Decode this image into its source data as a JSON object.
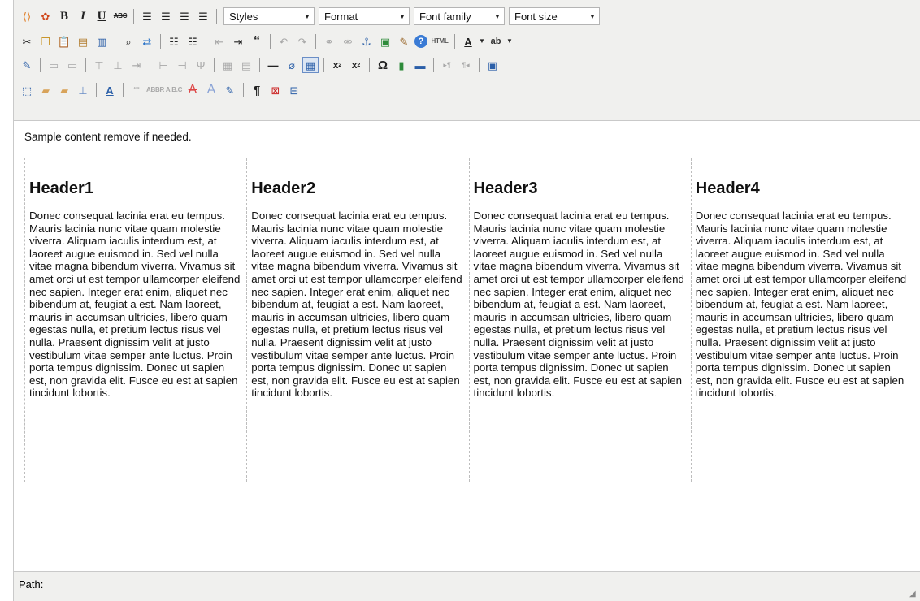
{
  "toolbar": {
    "styles_value": "Styles",
    "format_value": "Format",
    "fontfamily_value": "Font family",
    "fontsize_value": "Font size",
    "html_label": "HTML"
  },
  "content": {
    "sample_text": "Sample content remove if needed.",
    "columns": [
      {
        "header": "Header1",
        "body": "Donec consequat lacinia erat eu tempus. Mauris lacinia nunc vitae quam molestie viverra. Aliquam iaculis interdum est, at laoreet augue euismod in. Sed vel nulla vitae magna bibendum viverra. Vivamus sit amet orci ut est tempor ullamcorper eleifend nec sapien. Integer erat enim, aliquet nec bibendum at, feugiat a est. Nam laoreet, mauris in accumsan ultricies, libero quam egestas nulla, et pretium lectus risus vel nulla. Praesent dignissim velit at justo vestibulum vitae semper ante luctus. Proin porta tempus dignissim. Donec ut sapien est, non gravida elit. Fusce eu est at sapien tincidunt lobortis."
      },
      {
        "header": "Header2",
        "body": "Donec consequat lacinia erat eu tempus. Mauris lacinia nunc vitae quam molestie viverra. Aliquam iaculis interdum est, at laoreet augue euismod in. Sed vel nulla vitae magna bibendum viverra. Vivamus sit amet orci ut est tempor ullamcorper eleifend nec sapien. Integer erat enim, aliquet nec bibendum at, feugiat a est. Nam laoreet, mauris in accumsan ultricies, libero quam egestas nulla, et pretium lectus risus vel nulla. Praesent dignissim velit at justo vestibulum vitae semper ante luctus. Proin porta tempus dignissim. Donec ut sapien est, non gravida elit. Fusce eu est at sapien tincidunt lobortis."
      },
      {
        "header": "Header3",
        "body": "Donec consequat lacinia erat eu tempus. Mauris lacinia nunc vitae quam molestie viverra. Aliquam iaculis interdum est, at laoreet augue euismod in. Sed vel nulla vitae magna bibendum viverra. Vivamus sit amet orci ut est tempor ullamcorper eleifend nec sapien. Integer erat enim, aliquet nec bibendum at, feugiat a est. Nam laoreet, mauris in accumsan ultricies, libero quam egestas nulla, et pretium lectus risus vel nulla. Praesent dignissim velit at justo vestibulum vitae semper ante luctus. Proin porta tempus dignissim. Donec ut sapien est, non gravida elit. Fusce eu est at sapien tincidunt lobortis."
      },
      {
        "header": "Header4",
        "body": "Donec consequat lacinia erat eu tempus. Mauris lacinia nunc vitae quam molestie viverra. Aliquam iaculis interdum est, at laoreet augue euismod in. Sed vel nulla vitae magna bibendum viverra. Vivamus sit amet orci ut est tempor ullamcorper eleifend nec sapien. Integer erat enim, aliquet nec bibendum at, feugiat a est. Nam laoreet, mauris in accumsan ultricies, libero quam egestas nulla, et pretium lectus risus vel nulla. Praesent dignissim velit at justo vestibulum vitae semper ante luctus. Proin porta tempus dignissim. Donec ut sapien est, non gravida elit. Fusce eu est at sapien tincidunt lobortis."
      }
    ]
  },
  "statusbar": {
    "path_label": "Path:"
  }
}
